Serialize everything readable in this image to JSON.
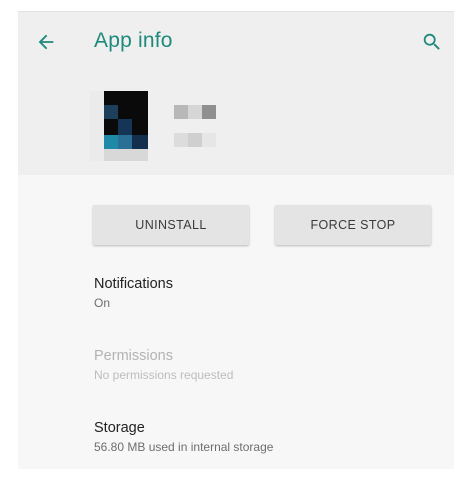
{
  "header": {
    "title": "App info",
    "back_icon": "arrow-back-icon",
    "search_icon": "search-icon",
    "accent_color": "#1e8a7b"
  },
  "app": {
    "icon": "app-icon-pixelated",
    "name_obscured": true
  },
  "actions": {
    "uninstall_label": "UNINSTALL",
    "force_stop_label": "FORCE STOP"
  },
  "settings": {
    "notifications": {
      "title": "Notifications",
      "subtitle": "On"
    },
    "permissions": {
      "title": "Permissions",
      "subtitle": "No permissions requested",
      "disabled": true
    },
    "storage": {
      "title": "Storage",
      "subtitle": "56.80 MB used in internal storage"
    }
  }
}
